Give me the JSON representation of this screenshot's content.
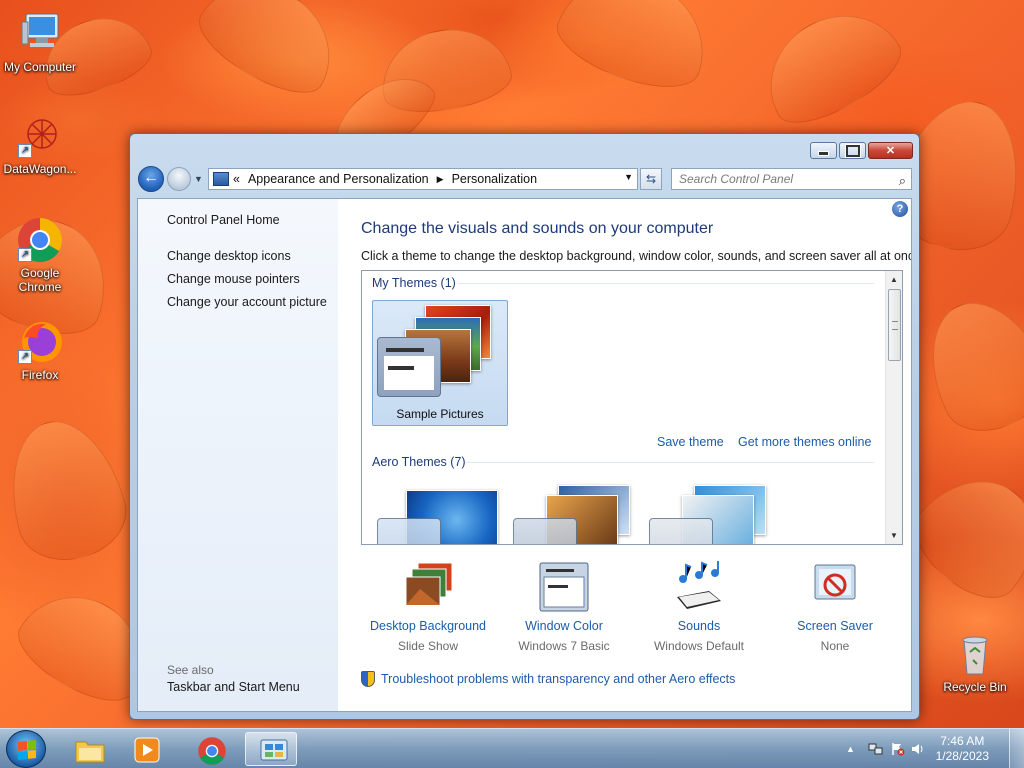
{
  "desktop": {
    "icons": [
      {
        "label": "My Computer",
        "icon": "computer-icon"
      },
      {
        "label": "DataWagon...",
        "icon": "datawagon-icon"
      },
      {
        "label": "Google Chrome",
        "icon": "chrome-icon"
      },
      {
        "label": "Firefox",
        "icon": "firefox-icon"
      },
      {
        "label": "Recycle Bin",
        "icon": "recycle-bin-icon"
      }
    ]
  },
  "window": {
    "breadcrumb": {
      "overflow": "«",
      "items": [
        "Appearance and Personalization",
        "Personalization"
      ]
    },
    "search_placeholder": "Search Control Panel",
    "left_pane": {
      "home": "Control Panel Home",
      "links": [
        "Change desktop icons",
        "Change mouse pointers",
        "Change your account picture"
      ],
      "see_also_title": "See also",
      "see_also_links": [
        "Taskbar and Start Menu"
      ]
    },
    "main": {
      "title": "Change the visuals and sounds on your computer",
      "description": "Click a theme to change the desktop background, window color, sounds, and screen saver all at once.",
      "help": "?",
      "my_themes_title": "My Themes (1)",
      "my_theme_name": "Sample Pictures",
      "save_theme": "Save theme",
      "get_more": "Get more themes online",
      "aero_themes_title": "Aero Themes (7)",
      "settings": [
        {
          "label": "Desktop Background",
          "value": "Slide Show",
          "icon": "desktop-background-icon"
        },
        {
          "label": "Window Color",
          "value": "Windows 7 Basic",
          "icon": "window-color-icon"
        },
        {
          "label": "Sounds",
          "value": "Windows Default",
          "icon": "sounds-icon"
        },
        {
          "label": "Screen Saver",
          "value": "None",
          "icon": "screen-saver-icon"
        }
      ],
      "troubleshoot": "Troubleshoot problems with transparency and other Aero effects"
    }
  },
  "taskbar": {
    "apps": [
      "explorer-icon",
      "media-player-icon",
      "chrome-icon",
      "control-panel-icon"
    ],
    "clock": {
      "time": "7:46 AM",
      "date": "1/28/2023"
    }
  },
  "colors": {
    "link": "#1c5ca8",
    "heading": "#1e3a78",
    "wallpaper": "#f2622a"
  }
}
